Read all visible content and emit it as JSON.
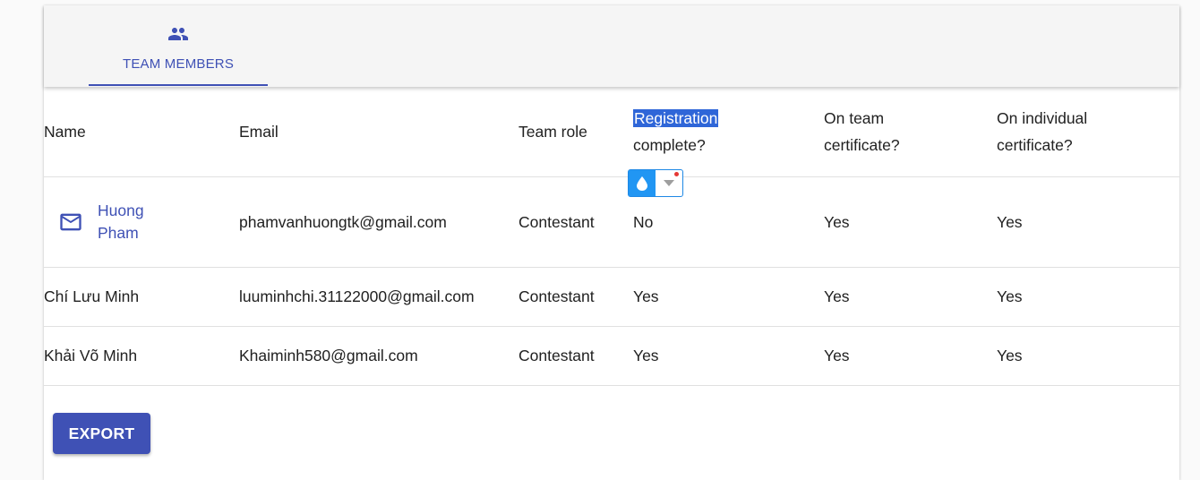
{
  "tabs": [
    {
      "label": "TEAM MEMBERS",
      "icon": "people-icon",
      "active": true
    }
  ],
  "table": {
    "headers": {
      "name": "Name",
      "email": "Email",
      "team_role": "Team role",
      "registration_line1": "Registration",
      "registration_line2": "complete?",
      "team_cert_line1": "On team",
      "team_cert_line2": "certificate?",
      "ind_cert_line1": "On individual",
      "ind_cert_line2": "certificate?"
    },
    "rows": [
      {
        "name_line1": "Huong",
        "name_line2": "Pham",
        "email": "phamvanhuongtk@gmail.com",
        "team_role": "Contestant",
        "registration_complete": "No",
        "on_team_certificate": "Yes",
        "on_individual_certificate": "Yes"
      },
      {
        "name": "Chí Lưu Minh",
        "email": "luuminhchi.31122000@gmail.com",
        "team_role": "Contestant",
        "registration_complete": "Yes",
        "on_team_certificate": "Yes",
        "on_individual_certificate": "Yes"
      },
      {
        "name": "Khải Võ Minh",
        "email": "Khaiminh580@gmail.com",
        "team_role": "Contestant",
        "registration_complete": "Yes",
        "on_team_certificate": "Yes",
        "on_individual_certificate": "Yes"
      }
    ]
  },
  "actions": {
    "export_label": "EXPORT"
  },
  "colors": {
    "primary": "#3f51b5",
    "selection_highlight": "#2f66d8",
    "widget_blue": "#2196f3",
    "notification_dot": "#e53935"
  },
  "icons": {
    "tab": "people-icon",
    "email": "mail-icon",
    "widget_left": "water-drop-icon",
    "widget_right": "caret-down-icon"
  }
}
